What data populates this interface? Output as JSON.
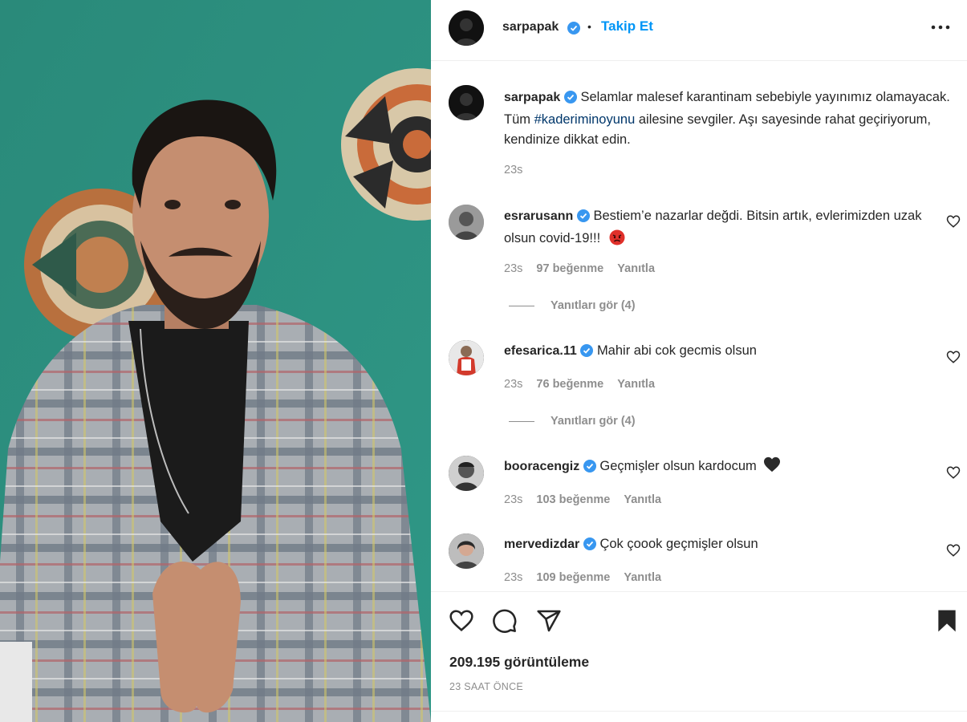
{
  "post": {
    "author": "sarpapak",
    "follow_label": "Takip Et",
    "separator": "•",
    "caption_pre": "Selamlar malesef karantinam sebebiyle yayınımız olamayacak. Tüm ",
    "caption_tag": "#kaderiminoyunu",
    "caption_post": " ailesine sevgiler. Aşı sayesinde rahat geçiriyorum, kendinize dikkat edin.",
    "caption_time": "23s",
    "views": "209.195 görüntüleme",
    "time_ago": "23 SAAT ÖNCE"
  },
  "comments": [
    {
      "user": "esrarusann",
      "verified": true,
      "text": "Bestiem’e nazarlar değdi. Bitsin artık, evlerimizden uzak olsun covid-19!!!",
      "emoji": "angry-face",
      "time": "23s",
      "likes": "97 beğenme",
      "reply": "Yanıtla",
      "view_replies": "Yanıtları gör (4)"
    },
    {
      "user": "efesarica.11",
      "verified": true,
      "text": "Mahir abi cok gecmis olsun",
      "time": "23s",
      "likes": "76 beğenme",
      "reply": "Yanıtla",
      "view_replies": "Yanıtları gör (4)"
    },
    {
      "user": "booracengiz",
      "verified": true,
      "text": "Geçmişler olsun kardocum",
      "emoji": "black-heart",
      "time": "23s",
      "likes": "103 beğenme",
      "reply": "Yanıtla"
    },
    {
      "user": "mervedizdar",
      "verified": true,
      "text": "Çok çoook geçmişler olsun",
      "time": "23s",
      "likes": "109 beğenme",
      "reply": "Yanıtla"
    }
  ],
  "icons": {
    "like": "heart-icon",
    "comment": "comment-icon",
    "share": "share-icon",
    "save": "bookmark-icon",
    "more": "more-options-icon",
    "verified": "verified-badge-icon"
  },
  "colors": {
    "accent": "#0095f6",
    "verified": "#3897f0",
    "photo_wall": "#2f8f80"
  }
}
